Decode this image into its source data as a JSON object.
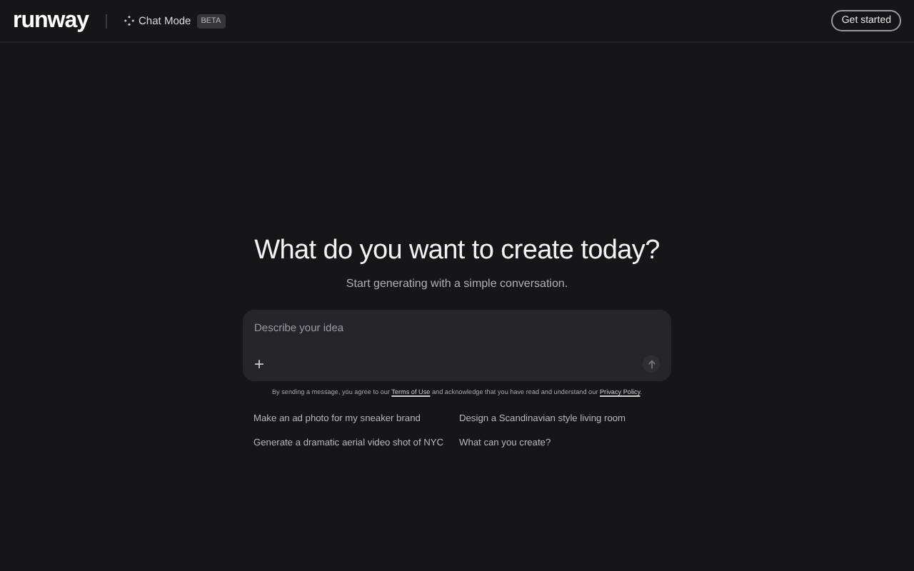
{
  "header": {
    "logo": "runway",
    "mode": "Chat Mode",
    "badge": "BETA",
    "cta": "Get started"
  },
  "hero": {
    "title": "What do you want to create today?",
    "subtitle": "Start generating with a simple conversation."
  },
  "composer": {
    "placeholder": "Describe your idea",
    "add": "+"
  },
  "disclaimer": [
    {
      "kind": "text",
      "text": "By sending a message, you agree to our "
    },
    {
      "kind": "link",
      "text": "Terms of Use"
    },
    {
      "kind": "text",
      "text": " and acknowledge that you have read and understand our "
    },
    {
      "kind": "link",
      "text": "Privacy Policy"
    },
    {
      "kind": "text",
      "text": "."
    }
  ],
  "suggestions": [
    "Make an ad photo for my sneaker brand",
    "Design a Scandinavian style living room",
    "Generate a dramatic aerial video shot of NYC",
    "What can you create?"
  ]
}
